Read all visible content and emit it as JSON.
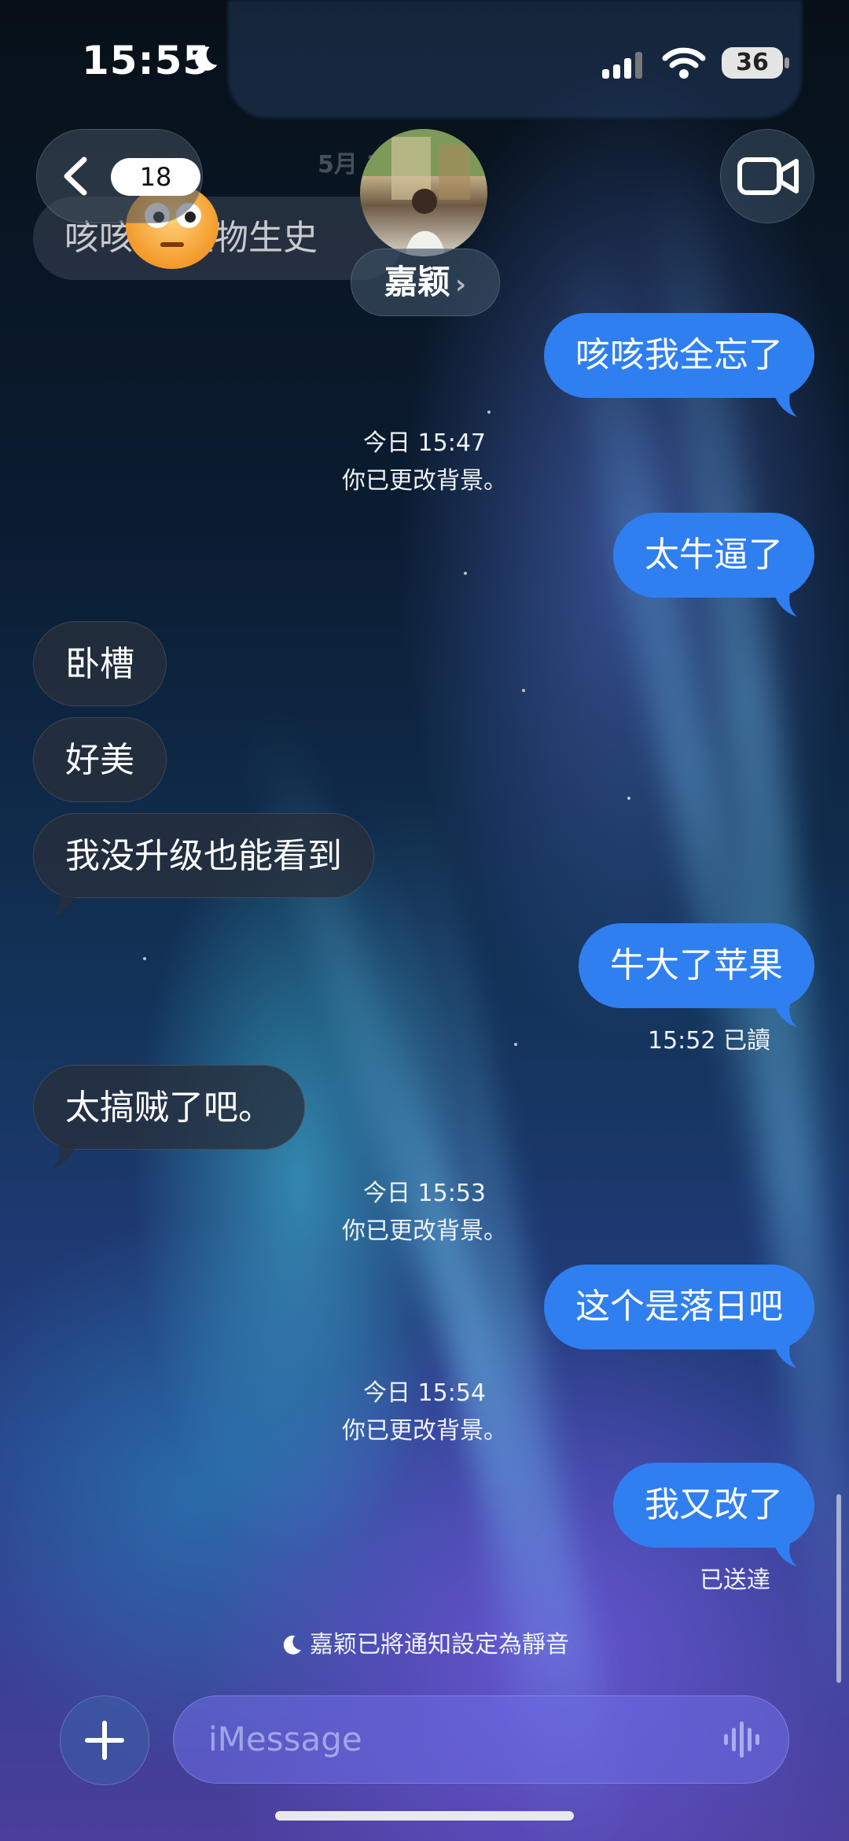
{
  "status_bar": {
    "time": "15:55",
    "battery": "36"
  },
  "header": {
    "back_count": "18",
    "contact_name": "嘉颖",
    "name_arrow": "›"
  },
  "faded": {
    "date_header": "5月  15:35",
    "partial_message": "咳咳   家是物生史"
  },
  "messages": [
    {
      "dir": "out",
      "text": "咳咳我全忘了"
    },
    {
      "dir": "system",
      "time": "今日 15:47",
      "text": "你已更改背景。"
    },
    {
      "dir": "out",
      "text": "太牛逼了"
    },
    {
      "dir": "in",
      "text": "卧槽"
    },
    {
      "dir": "in",
      "text": "好美"
    },
    {
      "dir": "in",
      "text": "我没升级也能看到"
    },
    {
      "dir": "out",
      "text": "牛大了苹果",
      "receipt": "15:52 已讀"
    },
    {
      "dir": "in",
      "text": "太搞贼了吧。"
    },
    {
      "dir": "system",
      "time": "今日 15:53",
      "text": "你已更改背景。"
    },
    {
      "dir": "out",
      "text": "这个是落日吧"
    },
    {
      "dir": "system",
      "time": "今日 15:54",
      "text": "你已更改背景。"
    },
    {
      "dir": "out",
      "text": "我又改了",
      "receipt": "已送達"
    }
  ],
  "mute_note": "嘉颖已將通知設定為靜音",
  "composer": {
    "placeholder": "iMessage"
  },
  "colors": {
    "outgoing_bubble": "#2f7ff0",
    "incoming_bubble": "#28303c"
  }
}
